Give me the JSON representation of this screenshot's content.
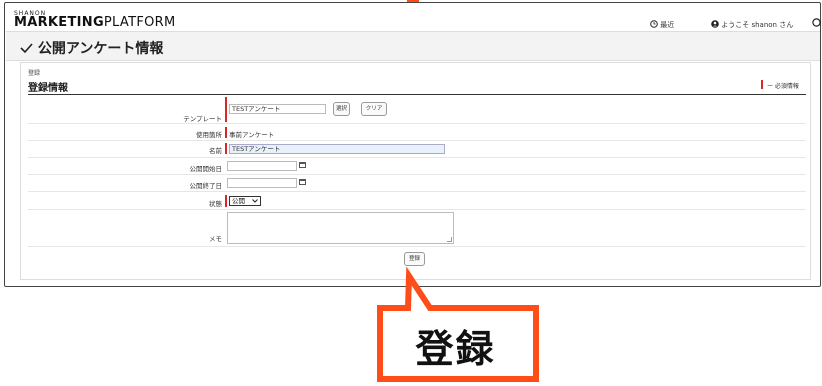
{
  "header": {
    "brand_small": "SHANON",
    "brand_main": "MARKETING",
    "brand_sub": "PLATFORM",
    "recent_label": "最近",
    "welcome_label": "ようこそ shanon さん",
    "help_icon": "circle-icon"
  },
  "page": {
    "title": "公開アンケート情報"
  },
  "form": {
    "breadcrumb": "登録",
    "section_title": "登録情報",
    "required_legend": "ー 必須情報",
    "template": {
      "label": "テンプレート",
      "value": "TESTアンケート",
      "select_button": "選択",
      "clear_button": "クリア"
    },
    "usage": {
      "label": "使用箇所",
      "value": "事前アンケート"
    },
    "name": {
      "label": "名前",
      "value": "TESTアンケート"
    },
    "start_date": {
      "label": "公開開始日",
      "value": ""
    },
    "end_date": {
      "label": "公開終了日",
      "value": ""
    },
    "status": {
      "label": "状態",
      "selected": "公開"
    },
    "memo": {
      "label": "メモ",
      "value": ""
    },
    "submit_button": "登録"
  },
  "annotation": {
    "callout_text": "登録",
    "accent_color": "#ff4d1a"
  }
}
